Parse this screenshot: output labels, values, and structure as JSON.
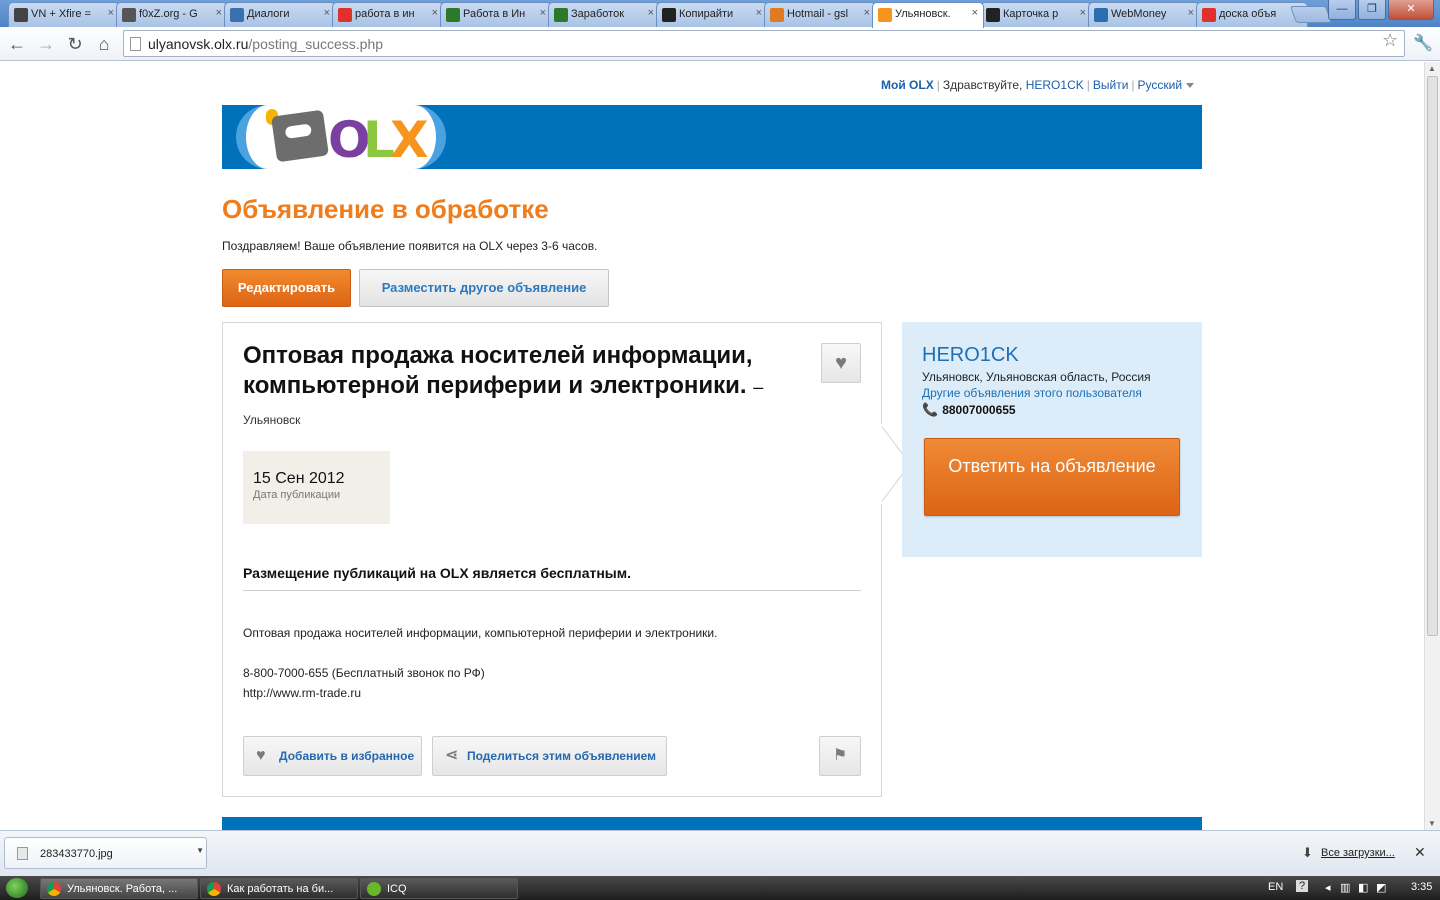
{
  "browser": {
    "tabs": [
      {
        "title": "VN + Xfire =",
        "icon": "controller-icon",
        "color": "#444"
      },
      {
        "title": "f0xZ.org - G",
        "icon": "f0xz-icon",
        "color": "#555"
      },
      {
        "title": "Диалоги",
        "icon": "play-icon",
        "color": "#3a6fb0"
      },
      {
        "title": "работа в ин",
        "icon": "yandex-icon",
        "color": "#e03030"
      },
      {
        "title": "Работа в Ин",
        "icon": "dollar-icon",
        "color": "#2a7a2a"
      },
      {
        "title": "Заработок",
        "icon": "dollar-icon",
        "color": "#2a7a2a"
      },
      {
        "title": "Копирайти",
        "icon": "a-icon",
        "color": "#222"
      },
      {
        "title": "Hotmail - gsl",
        "icon": "mail-icon",
        "color": "#e07a20"
      },
      {
        "title": "Ульяновск.",
        "icon": "olx-icon",
        "color": "#f7941d"
      },
      {
        "title": "Карточка р",
        "icon": "a-icon",
        "color": "#222"
      },
      {
        "title": "WebMoney",
        "icon": "globe-icon",
        "color": "#2a6fb0"
      },
      {
        "title": "доска объя",
        "icon": "yandex-icon",
        "color": "#e03030"
      }
    ],
    "active_tab_index": 8,
    "tab_close_glyph": "×",
    "url_host": "ulyanovsk.olx.ru",
    "url_path": "/posting_success.php"
  },
  "userbar": {
    "my_olx": "Мой OLX",
    "hello": "Здравствуйте,",
    "username": "HERO1CK",
    "logout": "Выйти",
    "language": "Русский"
  },
  "page": {
    "headline": "Объявление в обработке",
    "congrats": "Поздравляем! Ваше объявление появится на OLX через 3-6 часов.",
    "edit_button": "Редактировать",
    "post_another_button": "Разместить другое объявление"
  },
  "ad": {
    "title": "Оптовая продажа носителей информации, компьютерной периферии и электроники.",
    "title_suffix": "–",
    "city": "Ульяновск",
    "date": "15 Сен 2012",
    "date_label": "Дата публикации",
    "free_notice": "Размещение публикаций на OLX является бесплатным.",
    "description": [
      "Оптовая продажа носителей информации, компьютерной периферии и электроники.",
      "",
      "8-800-7000-655 (Бесплатный звонок по РФ)",
      "http://www.rm-trade.ru"
    ],
    "favorite_button": "Добавить в избранное",
    "share_button": "Поделиться этим объявлением"
  },
  "seller": {
    "name": "HERO1CK",
    "location": "Ульяновск, Ульяновская область, Россия",
    "other_ads_link": "Другие объявления этого пользователя",
    "phone": "88007000655",
    "reply_button": "Ответить на объявление"
  },
  "downloads": {
    "file": "283433770.jpg",
    "all_downloads": "Все загрузки..."
  },
  "taskbar": {
    "items": [
      {
        "label": "Ульяновск. Работа, ...",
        "icon": "chrome-icon"
      },
      {
        "label": "Как работать на би...",
        "icon": "chrome-icon"
      },
      {
        "label": "ICQ",
        "icon": "icq-icon"
      }
    ],
    "lang": "EN",
    "time": "3:35"
  },
  "colors": {
    "olx_blue": "#0072bc",
    "orange": "#f07c1c",
    "link_blue": "#1d70b8",
    "seller_bg": "#dcedf9"
  }
}
